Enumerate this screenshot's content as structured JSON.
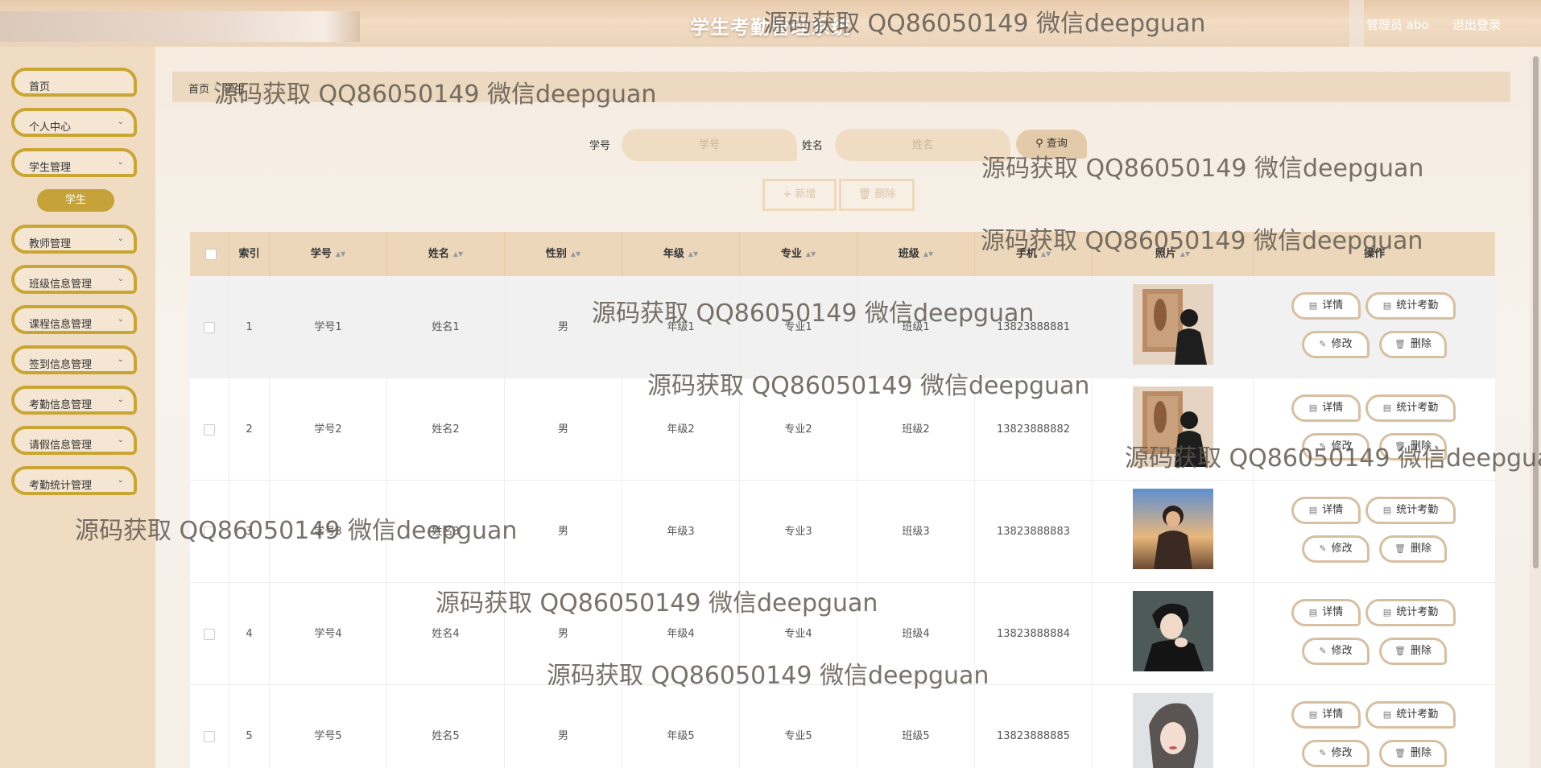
{
  "header": {
    "title": "学生考勤管理系统",
    "user_label": "管理员 abo",
    "logout": "退出登录"
  },
  "sidebar": {
    "items": [
      {
        "label": "首页",
        "has_children": false
      },
      {
        "label": "个人中心",
        "has_children": true
      },
      {
        "label": "学生管理",
        "has_children": true
      },
      {
        "label": "教师管理",
        "has_children": true
      },
      {
        "label": "班级信息管理",
        "has_children": true
      },
      {
        "label": "课程信息管理",
        "has_children": true
      },
      {
        "label": "签到信息管理",
        "has_children": true
      },
      {
        "label": "考勤信息管理",
        "has_children": true
      },
      {
        "label": "请假信息管理",
        "has_children": true
      },
      {
        "label": "考勤统计管理",
        "has_children": true
      }
    ],
    "active_submenu": "学生"
  },
  "breadcrumb": [
    "首页",
    "学生"
  ],
  "search": {
    "student_no_label": "学号",
    "student_no_placeholder": "学号",
    "student_no_value": "",
    "name_label": "姓名",
    "name_placeholder": "姓名",
    "name_value": "",
    "query_button": "查询"
  },
  "actions": {
    "add": "新增",
    "delete": "删除"
  },
  "table": {
    "columns": [
      "索引",
      "学号",
      "姓名",
      "性别",
      "年级",
      "专业",
      "班级",
      "手机",
      "照片",
      "操作"
    ],
    "rows": [
      {
        "index": "1",
        "student_no": "学号1",
        "name": "姓名1",
        "gender": "男",
        "grade": "年级1",
        "major": "专业1",
        "class": "班级1",
        "phone": "13823888881",
        "photo": "person-in-gallery"
      },
      {
        "index": "2",
        "student_no": "学号2",
        "name": "姓名2",
        "gender": "男",
        "grade": "年级2",
        "major": "专业2",
        "class": "班级2",
        "phone": "13823888882",
        "photo": "person-in-gallery"
      },
      {
        "index": "3",
        "student_no": "学号3",
        "name": "姓名3",
        "gender": "男",
        "grade": "年级3",
        "major": "专业3",
        "class": "班级3",
        "phone": "13823888883",
        "photo": "person-at-sunset"
      },
      {
        "index": "4",
        "student_no": "学号4",
        "name": "姓名4",
        "gender": "男",
        "grade": "年级4",
        "major": "专业4",
        "class": "班级4",
        "phone": "13823888884",
        "photo": "person-dark-portrait"
      },
      {
        "index": "5",
        "student_no": "学号5",
        "name": "姓名5",
        "gender": "男",
        "grade": "年级5",
        "major": "专业5",
        "class": "班级5",
        "phone": "13823888885",
        "photo": "person-light-portrait"
      }
    ],
    "row_actions": {
      "detail": "详情",
      "stats": "统计考勤",
      "edit": "修改",
      "delete": "删除"
    }
  },
  "watermark": "源码获取 QQ86050149 微信deepguan",
  "colors": {
    "accent_gold": "#c9a634",
    "header_beige": "#ecd7bb",
    "sidebar_bg": "#efdcc3"
  }
}
